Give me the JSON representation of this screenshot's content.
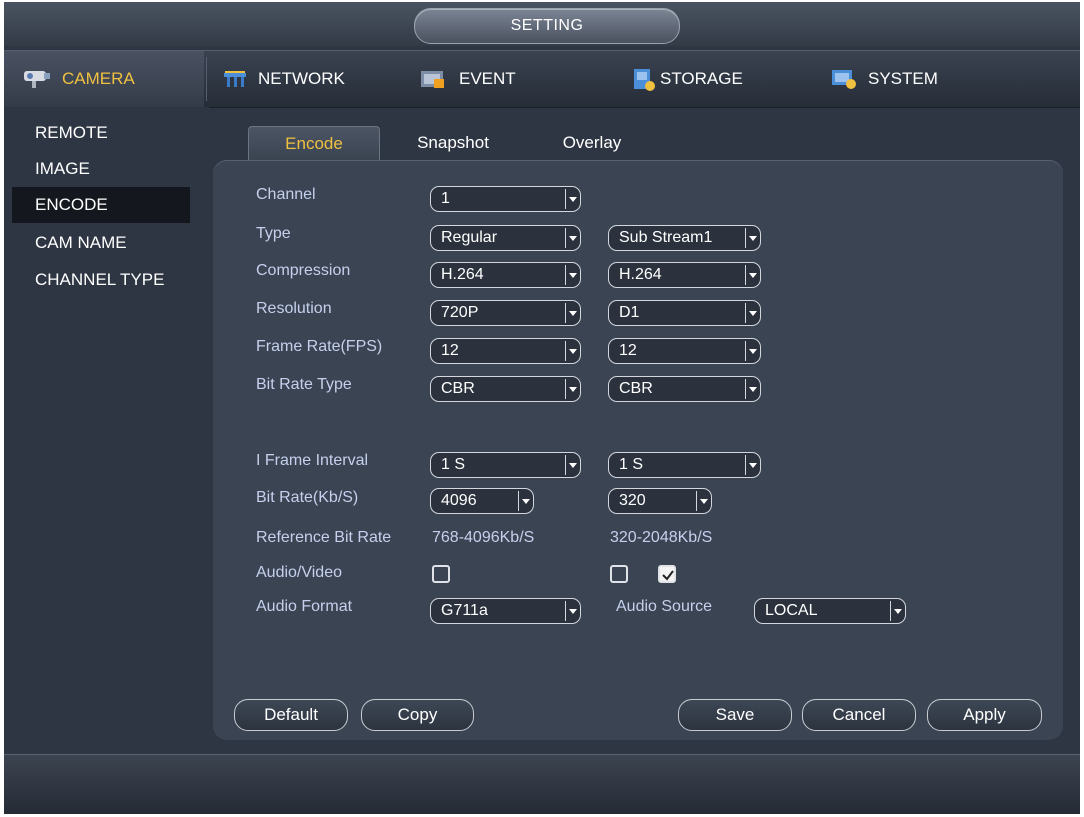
{
  "window": {
    "title": "SETTING"
  },
  "topnav": [
    {
      "label": "CAMERA",
      "icon": "camera-icon",
      "active": true
    },
    {
      "label": "NETWORK",
      "icon": "network-icon"
    },
    {
      "label": "EVENT",
      "icon": "event-icon"
    },
    {
      "label": "STORAGE",
      "icon": "storage-icon"
    },
    {
      "label": "SYSTEM",
      "icon": "system-icon"
    }
  ],
  "sidebar": {
    "items": [
      {
        "label": "REMOTE"
      },
      {
        "label": "IMAGE"
      },
      {
        "label": "ENCODE",
        "active": true
      },
      {
        "label": "CAM NAME"
      },
      {
        "label": "CHANNEL TYPE"
      }
    ]
  },
  "tabs": [
    {
      "label": "Encode",
      "active": true
    },
    {
      "label": "Snapshot"
    },
    {
      "label": "Overlay"
    }
  ],
  "form": {
    "channel": {
      "label": "Channel",
      "value": "1"
    },
    "type": {
      "label": "Type",
      "main": "Regular",
      "sub": "Sub Stream1"
    },
    "compression": {
      "label": "Compression",
      "main": "H.264",
      "sub": "H.264"
    },
    "resolution": {
      "label": "Resolution",
      "main": "720P",
      "sub": "D1"
    },
    "frame_rate": {
      "label": "Frame Rate(FPS)",
      "main": "12",
      "sub": "12"
    },
    "bit_rate_type": {
      "label": "Bit Rate Type",
      "main": "CBR",
      "sub": "CBR"
    },
    "i_frame": {
      "label": "I Frame Interval",
      "main": "1 S",
      "sub": "1 S"
    },
    "bit_rate": {
      "label": "Bit Rate(Kb/S)",
      "main": "4096",
      "sub": "320"
    },
    "ref_bit_rate": {
      "label": "Reference Bit Rate",
      "main": "768-4096Kb/S",
      "sub": "320-2048Kb/S"
    },
    "audio_video": {
      "label": "Audio/Video",
      "main_checked": false,
      "sub_checked": false,
      "sub_audio_checked": true
    },
    "audio_format": {
      "label": "Audio Format",
      "value": "G711a"
    },
    "audio_source": {
      "label": "Audio Source",
      "value": "LOCAL"
    }
  },
  "buttons": {
    "default": "Default",
    "copy": "Copy",
    "save": "Save",
    "cancel": "Cancel",
    "apply": "Apply"
  },
  "colors": {
    "accent": "#f0c040",
    "label": "#c6d0ec",
    "panel": "#3a4453",
    "background": "#2e3643"
  }
}
